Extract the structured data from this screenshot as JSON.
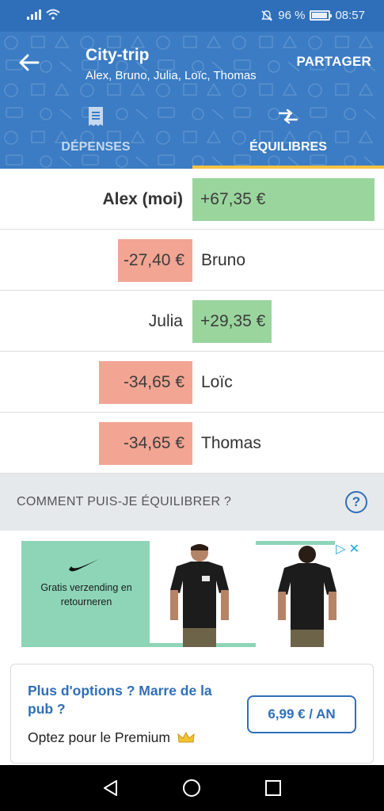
{
  "status_bar": {
    "battery_text": "96 %",
    "battery_level": 0.96,
    "time": "08:57",
    "icons": [
      "signal-icon",
      "wifi-icon",
      "mute-icon",
      "battery-icon"
    ]
  },
  "header": {
    "title": "City-trip",
    "participants": "Alex, Bruno, Julia, Loïc, Thomas",
    "share_label": "PARTAGER",
    "background_color": "#3b7cc4"
  },
  "tabs": [
    {
      "label": "DÉPENSES",
      "icon": "receipt-icon",
      "active": false
    },
    {
      "label": "ÉQUILIBRES",
      "icon": "balance-arrows-icon",
      "active": true
    }
  ],
  "balances": [
    {
      "name": "Alex (moi)",
      "amount": "+67,35 €",
      "value": 67.35,
      "is_me": true
    },
    {
      "name": "Bruno",
      "amount": "-27,40 €",
      "value": -27.4,
      "is_me": false
    },
    {
      "name": "Julia",
      "amount": "+29,35 €",
      "value": 29.35,
      "is_me": false
    },
    {
      "name": "Loïc",
      "amount": "-34,65 €",
      "value": -34.65,
      "is_me": false
    },
    {
      "name": "Thomas",
      "amount": "-34,65 €",
      "value": -34.65,
      "is_me": false
    }
  ],
  "colors": {
    "positive": "#9ad59d",
    "negative": "#f2a593",
    "accent": "#2f6fb9",
    "tab_indicator": "#f5c242"
  },
  "help": {
    "text": "COMMENT PUIS-JE ÉQUILIBRER ?",
    "icon": "help-icon"
  },
  "ad": {
    "text": "Gratis verzending en retourneren",
    "brand_logo": "swoosh-logo"
  },
  "premium": {
    "title": "Plus d'options ? Marre de la pub ?",
    "subtitle": "Optez pour le Premium",
    "price": "6,99 € / AN"
  }
}
